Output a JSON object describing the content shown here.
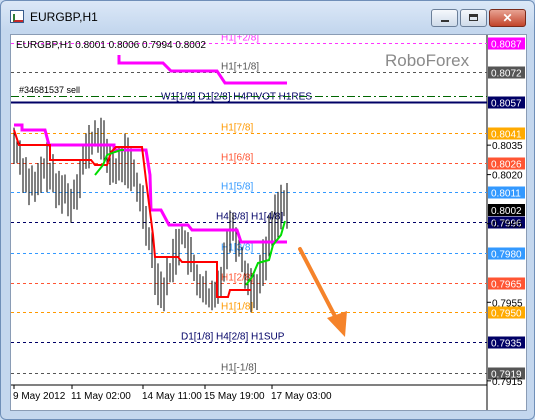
{
  "window": {
    "title": "EURGBP,H1",
    "icon": "chart-window-icon",
    "controls": {
      "minimize": "minimize-icon",
      "maximize": "maximize-icon",
      "close": "close-icon"
    }
  },
  "header": {
    "info": "EURGBP,H1  0.8001 0.8006 0.7994 0.8002",
    "order": "#34681537 sell",
    "watermark": "RoboForex"
  },
  "colors": {
    "background": "#ffffff",
    "price_bars": "#000000",
    "pink_line": "#ff00ff",
    "red_line": "#ff0000",
    "green_line": "#00dd00",
    "arrow": "#f5832a",
    "level_blue": "#3399ff",
    "level_orange": "#ff9900",
    "level_red": "#ff5533",
    "level_navy": "#000066",
    "level_gray": "#555555"
  },
  "levels": [
    {
      "label": "H1[+2/8]",
      "value": "0.8087",
      "color": "#ff33ff",
      "tag_bg": "#ff00ff",
      "style": "dash"
    },
    {
      "label": "H1[+1/8]",
      "value": "0.8072",
      "color": "#555555",
      "tag_bg": "#555555",
      "style": "dash"
    },
    {
      "label": "W1[1/8] D1[2/8] H4PIVOT H1RES",
      "value": "0.8057",
      "color": "#000066",
      "tag_bg": "#000066",
      "style": "solid"
    },
    {
      "label": "H1[7/8]",
      "value": "0.8041",
      "color": "#ff9900",
      "tag_bg": "#ffaa00",
      "style": "dash"
    },
    {
      "label": "H1[6/8]",
      "value": "0.8026",
      "color": "#ff5533",
      "tag_bg": "#ff5533",
      "style": "dash"
    },
    {
      "label": "H1[5/8]",
      "value": "0.8011",
      "color": "#3399ff",
      "tag_bg": "#3399ff",
      "style": "dash"
    },
    {
      "label": "H4[3/8] H1[4/8]",
      "value": "0.7996",
      "color": "#000066",
      "tag_bg": "#000066",
      "style": "dash"
    },
    {
      "label": "H1[3/8]",
      "value": "0.7980",
      "color": "#3399ff",
      "tag_bg": "#3399ff",
      "style": "dash"
    },
    {
      "label": "H1[2/8]",
      "value": "0.7965",
      "color": "#ff5533",
      "tag_bg": "#ff5533",
      "style": "dash"
    },
    {
      "label": "H1[1/8]",
      "value": "0.7950",
      "color": "#ff9900",
      "tag_bg": "#ffaa00",
      "style": "dash"
    },
    {
      "label": "D1[1/8] H4[2/8] H1SUP",
      "value": "0.7935",
      "color": "#000066",
      "tag_bg": "#000066",
      "style": "dash"
    },
    {
      "label": "H1[-1/8]",
      "value": "0.7919",
      "color": "#555555",
      "tag_bg": "#555555",
      "style": "dash"
    }
  ],
  "order_level": {
    "value": 0.806,
    "color": "#006600"
  },
  "current_price": {
    "value": "0.8002",
    "numeric": 0.8002
  },
  "axis_ticks": [
    "0.8035",
    "0.8020",
    "0.7995",
    "0.7955",
    "0.7915"
  ],
  "x_ticks": [
    "9 May 2012",
    "11 May 02:00",
    "14 May 11:00",
    "15 May 19:00",
    "17 May 03:00"
  ],
  "arrow": {
    "direction": "down",
    "meaning": "forecast-down"
  }
}
